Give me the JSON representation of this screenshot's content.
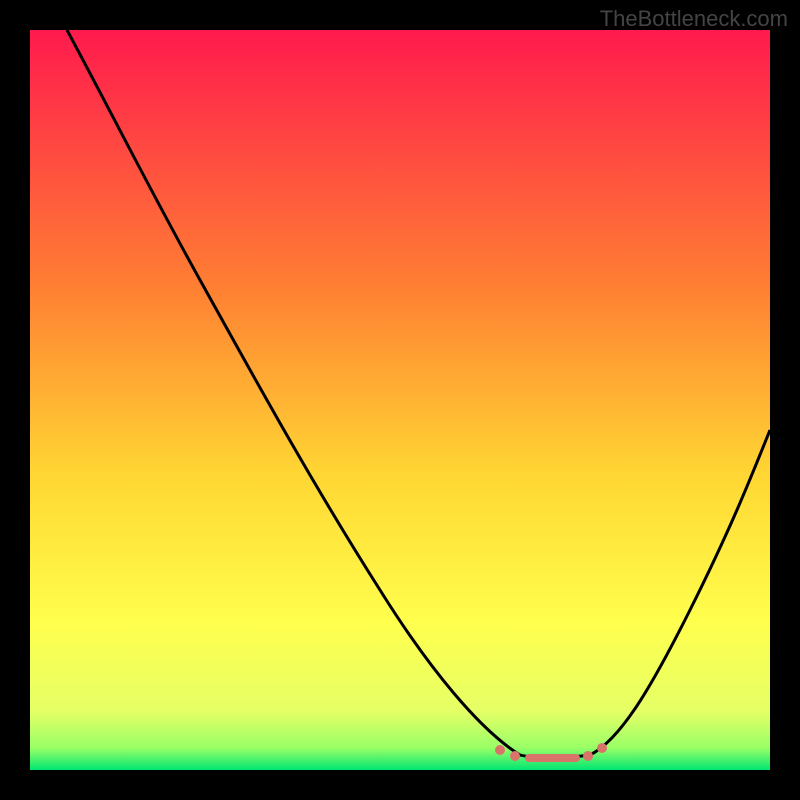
{
  "watermark": "TheBottleneck.com",
  "chart_data": {
    "type": "line",
    "title": "",
    "xlabel": "",
    "ylabel": "",
    "xlim": [
      0,
      100
    ],
    "ylim": [
      0,
      100
    ],
    "background_gradient": {
      "top": "#ff1a4d",
      "mid1": "#ff9933",
      "mid2": "#ffff33",
      "bottom": "#00e673"
    },
    "curve": {
      "description": "V-shaped bottleneck curve descending from top-left to a minimum near x≈72 then rising to the right edge",
      "x": [
        5,
        12,
        20,
        28,
        36,
        44,
        52,
        58,
        64,
        68,
        72,
        76,
        80,
        86,
        92,
        100
      ],
      "y": [
        100,
        88,
        76,
        64,
        52,
        40,
        28,
        19,
        10,
        4,
        0,
        0,
        4,
        14,
        28,
        48
      ]
    },
    "optimal_band": {
      "description": "flat region at bottom marking optimal range",
      "x_start": 62,
      "x_end": 80,
      "color": "#d9746b"
    }
  }
}
